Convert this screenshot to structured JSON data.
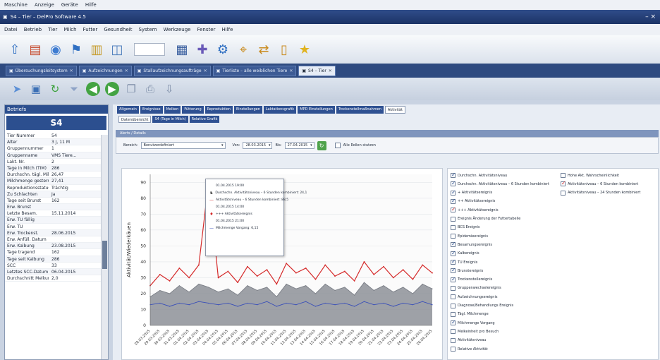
{
  "sysmenu": [
    "Maschine",
    "Anzeige",
    "Geräte",
    "Hilfe"
  ],
  "window": {
    "title": "S4 – Tier – DelPro Software 4.5",
    "close": "– ×"
  },
  "menubar": [
    "Datei",
    "Betrieb",
    "Tier",
    "Milch",
    "Futter",
    "Gesundheit",
    "System",
    "Werkzeuge",
    "Fenster",
    "Hilfe"
  ],
  "doctabs": [
    {
      "label": "Übersuchungsleitsystem",
      "active": false
    },
    {
      "label": "Aufzeichnungen",
      "active": false
    },
    {
      "label": "Stallaufzeichnungsaufträge",
      "active": false
    },
    {
      "label": "Tierliste – alle weiblichen Tiere",
      "active": false
    },
    {
      "label": "S4 – Tier",
      "active": true
    }
  ],
  "leftpanel": {
    "header": "Betriefs",
    "title": "S4",
    "rows": [
      [
        "Tier Nummer",
        "54"
      ],
      [
        "Alter",
        "3 J, 11 M"
      ],
      [
        "Gruppennummer",
        "1"
      ],
      [
        "Gruppenname",
        "VMS Tiere..."
      ],
      [
        "Lakt. Nr.",
        "2"
      ],
      [
        "Tage in Milch (TIM)",
        "286"
      ],
      [
        "Durchschn. tägl. Milch...",
        "26,47"
      ],
      [
        "Milchmenge gestern",
        "27,41"
      ],
      [
        "Reproduktionsstatus",
        "Trächtig"
      ],
      [
        "Zu Schlachten",
        "Ja"
      ],
      [
        "Tage seit Brunst",
        "162"
      ],
      [
        "Erw. Brunst",
        ""
      ],
      [
        "Letzte Besam.",
        "15.11.2014"
      ],
      [
        "Erw. TU fällig",
        ""
      ],
      [
        "Erw. TU",
        ""
      ],
      [
        "Erw. Trockenst.",
        "28.06.2015"
      ],
      [
        "Erw. Anfüll. Datum",
        ""
      ],
      [
        "Erw. Kalbung",
        "23.08.2015"
      ],
      [
        "Tage tragend",
        "162"
      ],
      [
        "Tage seit Kalbung",
        "286"
      ],
      [
        "SCC",
        "33"
      ],
      [
        "Letztes SCC-Datum",
        "06.04.2015"
      ],
      [
        "Durchschnitt Melkung...",
        "2,0"
      ]
    ]
  },
  "content_tabs": [
    {
      "label": "Allgemein",
      "active": false
    },
    {
      "label": "Ereignisse",
      "active": false
    },
    {
      "label": "Melken",
      "active": false
    },
    {
      "label": "Fütterung",
      "active": false
    },
    {
      "label": "Reproduktion",
      "active": false
    },
    {
      "label": "Einstellungen",
      "active": false
    },
    {
      "label": "Laktationsgrafik",
      "active": false
    },
    {
      "label": "MPD Einstellungen",
      "active": false
    },
    {
      "label": "Trockenstellmaßnahmen",
      "active": false
    },
    {
      "label": "Aktivität",
      "active": true
    }
  ],
  "sub_tabs": [
    {
      "label": "Datenübersicht",
      "active": true
    },
    {
      "label": "S4 (Tage in Milch)",
      "active": false
    },
    {
      "label": "Relative Grafik",
      "active": false
    }
  ],
  "section_header": "Alerts / Details",
  "filter": {
    "bereich_label": "Bereich:",
    "bereich_value": "Benutzerdefiniert",
    "von_label": "Von:",
    "von_value": "28.03.2015",
    "bis_label": "Bis:",
    "bis_value": "27.04.2015",
    "checkbox_label": "Alle Rollen stutzen"
  },
  "chart_data": {
    "type": "area",
    "ylabel": "Aktivität/Wiederkäuen",
    "ylim": [
      0,
      95
    ],
    "yticks": [
      0,
      10,
      20,
      30,
      40,
      50,
      60,
      70,
      80,
      90
    ],
    "x": [
      "28.03.2015",
      "29.03.2015",
      "30.03.2015",
      "31.03.2015",
      "01.04.2015",
      "02.04.2015",
      "03.04.2015",
      "04.04.2015",
      "05.04.2015",
      "06.04.2015",
      "07.04.2015",
      "08.04.2015",
      "09.04.2015",
      "10.04.2015",
      "11.04.2015",
      "12.04.2015",
      "13.04.2015",
      "14.04.2015",
      "15.04.2015",
      "16.04.2015",
      "17.04.2015",
      "18.04.2015",
      "19.04.2015",
      "20.04.2015",
      "21.04.2015",
      "22.04.2015",
      "23.04.2015",
      "24.04.2015",
      "25.04.2015",
      "26.04.2015"
    ],
    "series": [
      {
        "name": "Durchschn. Aktivitätsniveau – 6 Stunden kombiniert",
        "color": "#d52a2a",
        "values": [
          25,
          32,
          28,
          36,
          30,
          38,
          90,
          30,
          34,
          27,
          37,
          31,
          35,
          26,
          39,
          33,
          36,
          29,
          38,
          31,
          34,
          28,
          40,
          32,
          37,
          30,
          35,
          29,
          38,
          33
        ]
      },
      {
        "name": "Durchschn. Aktivitätsniveau",
        "color": "#7b7f87",
        "values": [
          18,
          22,
          20,
          25,
          21,
          26,
          24,
          21,
          23,
          19,
          25,
          22,
          24,
          18,
          26,
          23,
          25,
          20,
          26,
          22,
          24,
          19,
          27,
          22,
          25,
          21,
          24,
          20,
          26,
          23
        ]
      },
      {
        "name": "Milchmenge Vorgang",
        "color": "#3a4fb8",
        "values": [
          13,
          14,
          12,
          14,
          13,
          15,
          14,
          13,
          14,
          12,
          14,
          13,
          15,
          12,
          14,
          13,
          15,
          12,
          14,
          13,
          14,
          12,
          15,
          13,
          14,
          12,
          14,
          13,
          15,
          13
        ]
      }
    ]
  },
  "tooltip": [
    {
      "sym": "",
      "text": "01.04.2015 19:00",
      "color": "#333"
    },
    {
      "sym": "♞",
      "text": "Durchschn. Aktivitätsniveau – 6 Stunden kombiniert: 24,1",
      "color": "#555"
    },
    {
      "sym": "—",
      "text": "Aktivitätsniveau – 6 Stunden kombiniert: 88,5",
      "color": "#d52a2a"
    },
    {
      "sym": "",
      "text": "01.04.2015 14:00",
      "color": "#333"
    },
    {
      "sym": "♦",
      "text": "+++ Aktivitätsereignis",
      "color": "#d52a2a"
    },
    {
      "sym": "",
      "text": "01.04.2015 21:00",
      "color": "#333"
    },
    {
      "sym": "—",
      "text": "Milchmenge Vorgang: 6,15",
      "color": "#3a4fb8"
    }
  ],
  "legend": {
    "col1": [
      {
        "label": "Durchschn. Aktivitätsniveau",
        "checked": true,
        "red": false
      },
      {
        "label": "Durchschn. Aktivitätsniveau – 6 Stunden kombiniert",
        "checked": true,
        "red": false
      },
      {
        "label": "+ Aktivitätsereignis",
        "checked": true,
        "red": false
      },
      {
        "label": "++ Aktivitätsereignis",
        "checked": true,
        "red": false
      },
      {
        "label": "+++ Aktivitätsereignis",
        "checked": true,
        "red": true
      },
      {
        "label": "Ereignis Änderung der Futtertabelle",
        "checked": false,
        "red": false
      },
      {
        "label": "BCS Ereignis",
        "checked": false,
        "red": false
      },
      {
        "label": "Epidemieereignis",
        "checked": false,
        "red": false
      },
      {
        "label": "Besamungsereignis",
        "checked": true,
        "red": false
      },
      {
        "label": "Kalbereignis",
        "checked": true,
        "red": false
      },
      {
        "label": "TU Ereignis",
        "checked": true,
        "red": false
      },
      {
        "label": "Brunstereignis",
        "checked": true,
        "red": false
      },
      {
        "label": "Trockenstellereignis",
        "checked": true,
        "red": false
      },
      {
        "label": "Gruppenwechselereignis",
        "checked": false,
        "red": false
      },
      {
        "label": "Aufzeichnungsereignis",
        "checked": false,
        "red": false
      },
      {
        "label": "Diagnose/Behandlungs Ereignis",
        "checked": false,
        "red": false
      },
      {
        "label": "Tägl. Milchmenge",
        "checked": false,
        "red": false
      },
      {
        "label": "Milchmenge Vorgang",
        "checked": true,
        "red": false
      },
      {
        "label": "Melkeinheit pro Besuch",
        "checked": false,
        "red": false
      },
      {
        "label": "Aktivitätsniveau",
        "checked": false,
        "red": false
      },
      {
        "label": "Relative Aktivität",
        "checked": false,
        "red": false
      }
    ],
    "col2": [
      {
        "label": "Hohe Akt. Wahrscheinlichkeit",
        "checked": false,
        "red": false
      },
      {
        "label": "Aktivitätsniveau – 6 Stunden kombiniert",
        "checked": true,
        "red": true
      },
      {
        "label": "Aktivitätsniveau – 24 Stunden kombiniert",
        "checked": false,
        "red": false
      }
    ]
  }
}
